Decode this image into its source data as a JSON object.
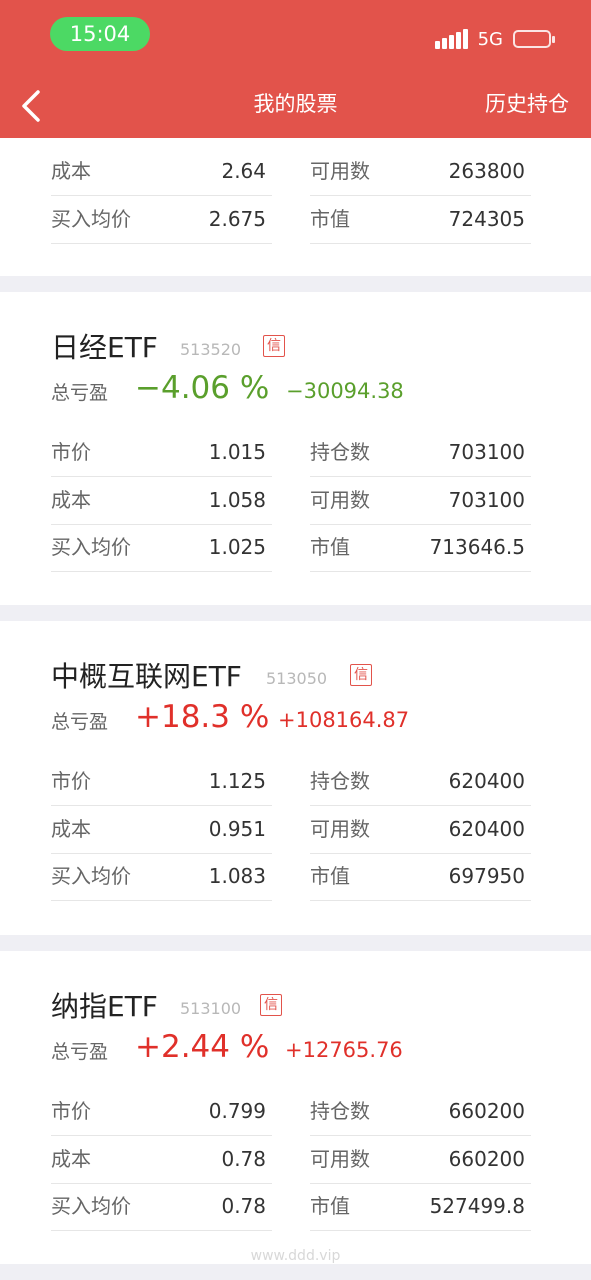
{
  "status_bar": {
    "time": "15:04",
    "network": "5G"
  },
  "nav": {
    "title": "我的股票",
    "history": "历史持仓"
  },
  "labels": {
    "profit_loss": "总亏盈",
    "price": "市价",
    "cost": "成本",
    "avg_buy": "买入均价",
    "holding": "持仓数",
    "available": "可用数",
    "market_value": "市值"
  },
  "partial_stock": {
    "cost": "2.64",
    "avg_buy": "2.675",
    "available": "263800",
    "market_value": "724305"
  },
  "stocks": [
    {
      "name": "日经ETF",
      "code": "513520",
      "badge": "信",
      "pl_pct": "−4.06 %",
      "pl_amount": "−30094.38",
      "trend": "down",
      "price": "1.015",
      "cost": "1.058",
      "avg_buy": "1.025",
      "holding": "703100",
      "available": "703100",
      "market_value": "713646.5"
    },
    {
      "name": "中概互联网ETF",
      "code": "513050",
      "badge": "信",
      "pl_pct": "+18.3 %",
      "pl_amount": "+108164.87",
      "trend": "up",
      "price": "1.125",
      "cost": "0.951",
      "avg_buy": "1.083",
      "holding": "620400",
      "available": "620400",
      "market_value": "697950"
    },
    {
      "name": "纳指ETF",
      "code": "513100",
      "badge": "信",
      "pl_pct": "+2.44 %",
      "pl_amount": "+12765.76",
      "trend": "up",
      "price": "0.799",
      "cost": "0.78",
      "avg_buy": "0.78",
      "holding": "660200",
      "available": "660200",
      "market_value": "527499.8"
    }
  ],
  "colors": {
    "header": "#e2534b",
    "up": "#e0302a",
    "down": "#5a9f2c",
    "time_pill": "#4cd964"
  },
  "watermark": "www.ddd.vip"
}
